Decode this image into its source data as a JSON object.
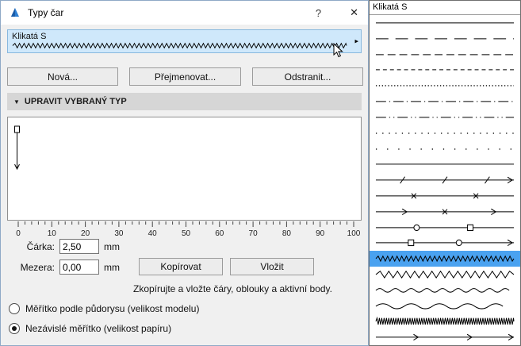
{
  "window": {
    "title": "Typy čar",
    "help_label": "?",
    "close_label": "✕"
  },
  "selector": {
    "selected_name": "Klikatá S",
    "pattern": "zigzag-s",
    "popup_arrow": "▸"
  },
  "actions": {
    "new_label": "Nová...",
    "rename_label": "Přejmenovat...",
    "delete_label": "Odstranit..."
  },
  "edit_section": {
    "collapse_arrow": "▼",
    "header": "UPRAVIT VYBRANÝ TYP",
    "ruler_labels": [
      "0",
      "10",
      "20",
      "30",
      "40",
      "50",
      "60",
      "70",
      "80",
      "90",
      "100"
    ],
    "dash_label": "Čárka:",
    "dash_value": "2,50",
    "dash_unit": "mm",
    "gap_label": "Mezera:",
    "gap_value": "0,00",
    "gap_unit": "mm",
    "copy_label": "Kopírovat",
    "paste_label": "Vložit",
    "hint": "Zkopírujte a vložte čáry, oblouky a aktivní body.",
    "radio_model": {
      "label": "Měřítko podle půdorysu (velikost modelu)",
      "checked": false
    },
    "radio_paper": {
      "label": "Nezávislé měřítko (velikost papíru)",
      "checked": true
    }
  },
  "preview_panel": {
    "header": "Klikatá S",
    "selected_index": 15,
    "items": [
      {
        "pattern": "solid"
      },
      {
        "pattern": "long-dash"
      },
      {
        "pattern": "dashed"
      },
      {
        "pattern": "short-dash"
      },
      {
        "pattern": "dotted"
      },
      {
        "pattern": "dash-dot"
      },
      {
        "pattern": "dash-dot-dot"
      },
      {
        "pattern": "sparse-dots"
      },
      {
        "pattern": "very-sparse-dots"
      },
      {
        "pattern": "solid"
      },
      {
        "pattern": "marks-slash"
      },
      {
        "pattern": "marks-x"
      },
      {
        "pattern": "marks-x-arrow"
      },
      {
        "pattern": "marks-circle-square"
      },
      {
        "pattern": "marks-circle-square-2"
      },
      {
        "pattern": "zigzag-s"
      },
      {
        "pattern": "triangle-wave"
      },
      {
        "pattern": "sine-wave"
      },
      {
        "pattern": "sine-wave-large"
      },
      {
        "pattern": "dense-zigzag"
      },
      {
        "pattern": "marks-arrow"
      }
    ]
  },
  "colors": {
    "selection_bg": "#cfe8fb",
    "selection_border": "#88b8de",
    "row_selected": "#4aa2f0",
    "dialog_bg": "#f0f0f0",
    "titlebar_bg": "#ffffff",
    "section_bg": "#d6d6d6"
  }
}
